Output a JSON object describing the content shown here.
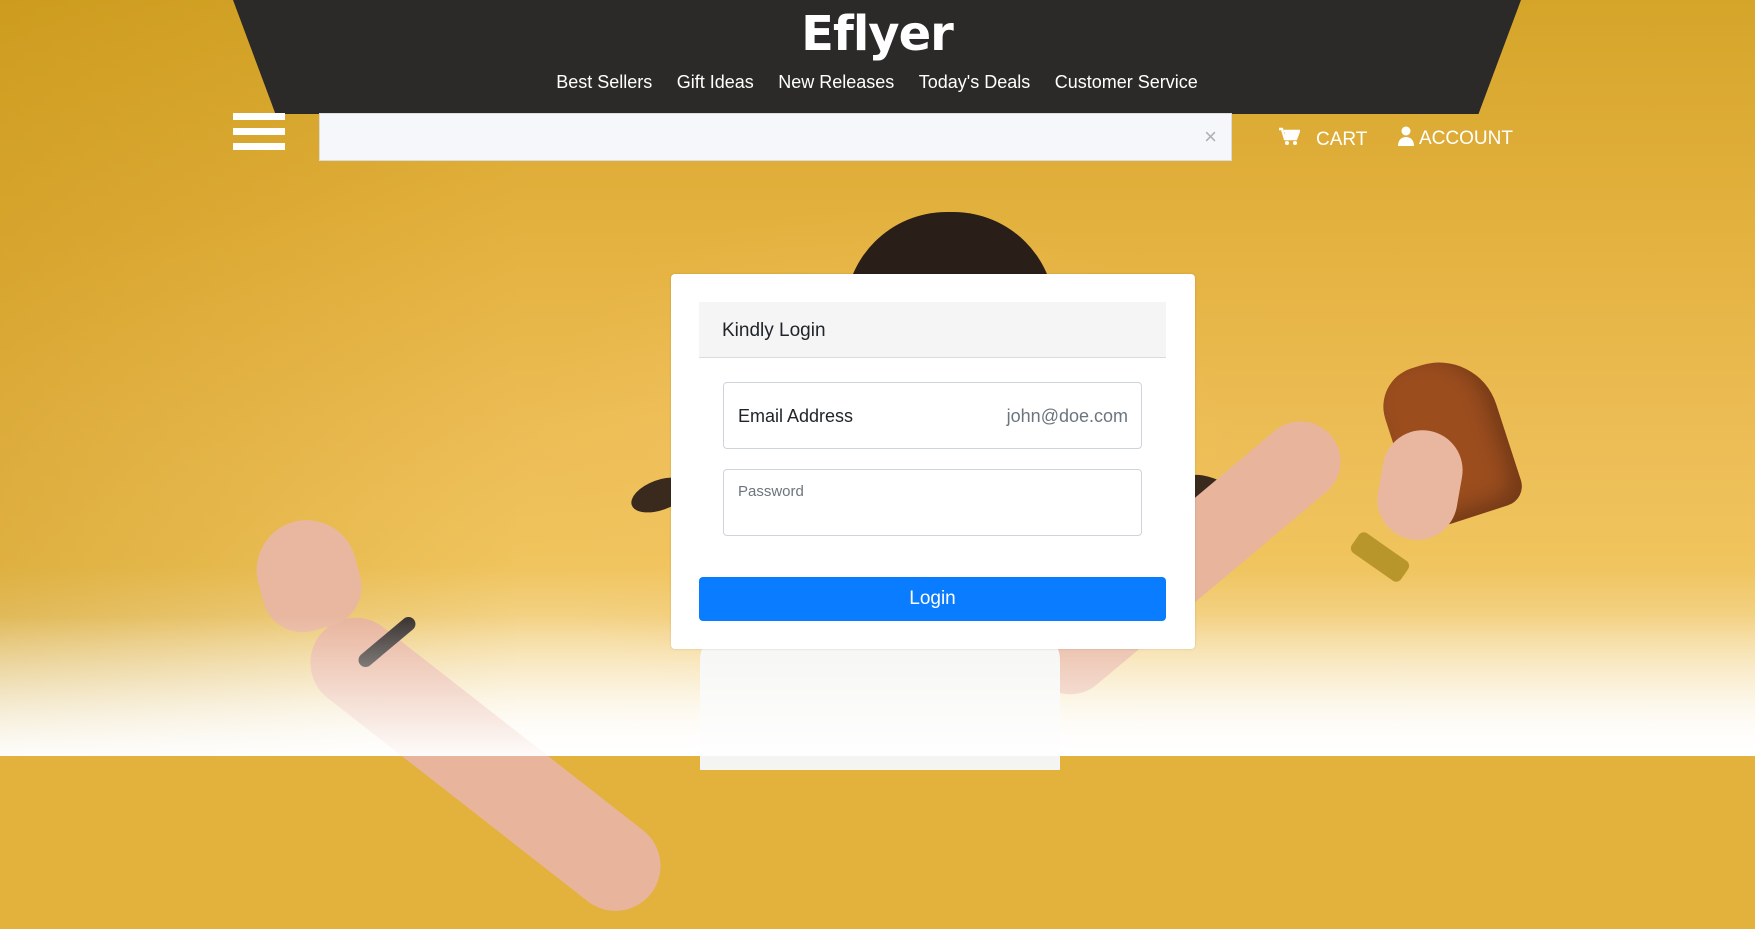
{
  "header": {
    "logo": "Eflyer",
    "nav": [
      "Best Sellers",
      "Gift Ideas",
      "New Releases",
      "Today's Deals",
      "Customer Service"
    ]
  },
  "search": {
    "value": "",
    "clear_icon": "×"
  },
  "cart": {
    "label": "CART",
    "icon": "cart-icon"
  },
  "account": {
    "label": "ACCOUNT",
    "icon": "user-icon"
  },
  "login_card": {
    "title": "Kindly Login",
    "email": {
      "label": "Email Address",
      "value": "john@doe.com"
    },
    "password": {
      "placeholder": "Password"
    },
    "submit_label": "Login"
  },
  "colors": {
    "header_bg": "#2b2a28",
    "accent": "#0a7cff",
    "background": "#e3b23c"
  }
}
